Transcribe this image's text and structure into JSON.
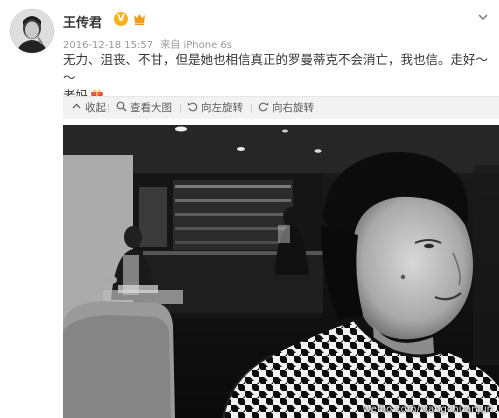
{
  "post": {
    "username": "王传君",
    "verified_mark": "V",
    "timestamp": "2016-12-18 15:57",
    "source": "来自 iPhone 6s",
    "text_line1": "无力、沮丧、不甘，但是她也相信真正的罗曼蒂克不会消亡，我也信。走好～～",
    "text_line2": "老妈",
    "icons": {
      "avatar": "avatar-photo",
      "verified": "verified-badge-icon",
      "member": "vip-member-icon",
      "menu": "chevron-down-icon",
      "gift": "gift-emoji-icon"
    },
    "accent_color": "#f6b21a"
  },
  "toolbar": {
    "collapse": "收起",
    "view_large": "查看大图",
    "rotate_left": "向左旋转",
    "rotate_right": "向右旋转"
  },
  "photo": {
    "description_icon": "photo-image",
    "watermark": "weibo.com/wangchuanjun",
    "watermark_small": "大小"
  }
}
